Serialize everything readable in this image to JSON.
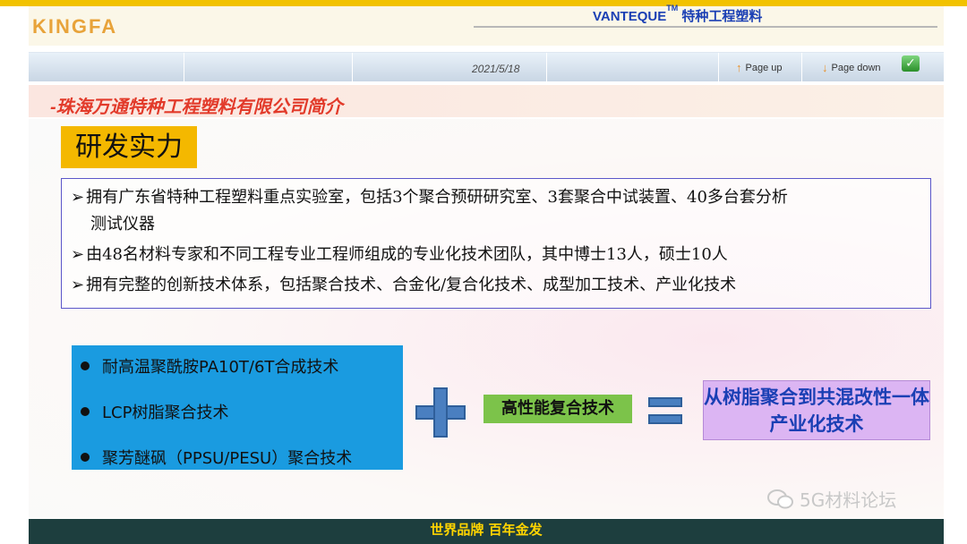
{
  "header": {
    "logo": "KINGFA",
    "title_brand": "VANTEQUE",
    "title_tm": "TM",
    "title_text": "特种工程塑料"
  },
  "navbar": {
    "date": "2021/5/18",
    "page_up": "Page up",
    "page_down": "Page down"
  },
  "subtitle": "-珠海万通特种工程塑料有限公司简介",
  "section_heading": "研发实力",
  "bullets": [
    {
      "line1": "拥有广东省特种工程塑料重点实验室，包括3个聚合预研研究室、3套聚合中试装置、40多台套分析",
      "line2": "测试仪器"
    },
    {
      "line1": "由48名材料专家和不同工程专业工程师组成的专业化技术团队，其中博士13人，硕士10人"
    },
    {
      "line1": "拥有完整的创新技术体系，包括聚合技术、合金化/复合化技术、成型加工技术、产业化技术"
    }
  ],
  "bullet_marker": "➢",
  "tech_list": [
    "耐高温聚酰胺PA10T/6T合成技术",
    "LCP树脂聚合技术",
    "聚芳醚砜（PPSU/PESU）聚合技术"
  ],
  "middle_label": "高性能复合技术",
  "result_label": "从树脂聚合到共混改性一体产业化技术",
  "footer": "世界品牌 百年金发",
  "watermark": "5G材料论坛",
  "colors": {
    "accent_yellow": "#f4b800",
    "title_blue": "#1a3fb4",
    "subtitle_red": "#e23a2a",
    "tech_blue": "#1a9be0",
    "green": "#7cc34a",
    "purple": "#dcb5f3",
    "footer_bg": "#1d3e3e",
    "footer_text": "#ffd400"
  },
  "icons": [
    "arrow-up-icon",
    "arrow-down-icon",
    "check-icon",
    "plus-icon",
    "equals-icon",
    "wechat-icon"
  ]
}
